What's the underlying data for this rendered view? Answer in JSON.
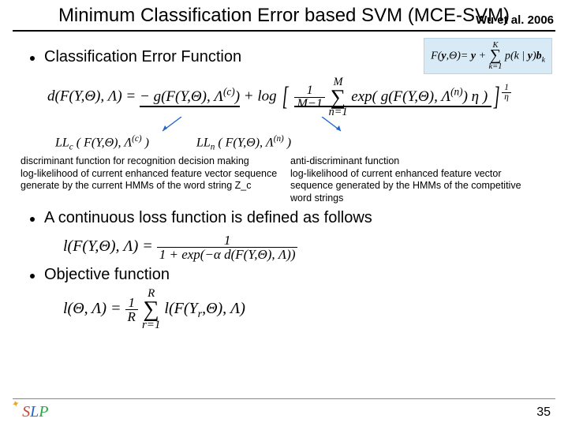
{
  "title": "Minimum Classification Error based SVM (MCE-SVM)",
  "citation": "Wu et al. 2006",
  "bullets": {
    "b1": "Classification Error Function",
    "b2": "A continuous loss function is defined as follows",
    "b3": "Objective function"
  },
  "equations": {
    "boxed": "F(y,Θ) = y + Σₖ₌₁ᴷ p(k | y) b_k",
    "main_lhs": "d(F(Y,Θ), Λ) = ",
    "main_term1": "− g(F(Y,Θ), Λ^(c))",
    "main_plus": " + log ",
    "main_bracket": "[ (1/(M−1)) Σₙ₌₁ᴹ exp( g(F(Y,Θ), Λ^(n)) η ) ]^(1/η)",
    "ll_c": "LL_c ( F(Y,Θ), Λ^(c) )",
    "ll_n": "LL_n ( F(Y,Θ), Λ^(n) )",
    "loss": "l(F(Y,Θ), Λ) = 1 / (1 + exp(−α d(F(Y,Θ), Λ)))",
    "objective": "l(Θ, Λ) = (1/R) Σᵣ₌₁ᴿ l(F(Yᵣ,Θ), Λ)"
  },
  "desc": {
    "left1": "discriminant function for recognition decision making",
    "left2": "log-likelihood of current enhanced feature vector sequence",
    "left3": "generate by the current HMMs of the word string Z_c",
    "right1": "anti-discriminant function",
    "right2": "log-likelihood of current enhanced feature vector",
    "right3": "sequence generated by the HMMs of the competitive",
    "right4": "word strings"
  },
  "logo": {
    "s": "S",
    "l": "L",
    "p": "P"
  },
  "page": "35"
}
